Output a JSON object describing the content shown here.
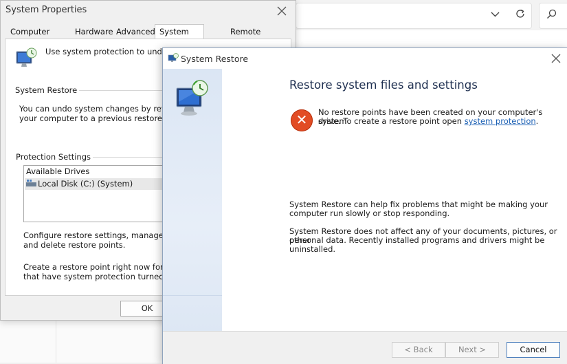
{
  "system_properties": {
    "title": "System Properties",
    "tabs": [
      {
        "label": "Computer Name"
      },
      {
        "label": "Hardware"
      },
      {
        "label": "Advanced"
      },
      {
        "label": "System Protection"
      },
      {
        "label": "Remote"
      }
    ],
    "intro_text": "Use system protection to undo unw",
    "system_restore_group": "System Restore",
    "system_restore_text_1": "You can undo system changes by revertin",
    "system_restore_text_2": "your computer to a previous restore point.",
    "protection_group": "Protection Settings",
    "drives_header": "Available Drives",
    "drive_item": "Local Disk (C:) (System)",
    "configure_text_1": "Configure restore settings, manage disk s",
    "configure_text_2": "and delete restore points.",
    "create_text_1": "Create a restore point right now for the dr",
    "create_text_2": "that have system protection turned on.",
    "ok_label": "OK"
  },
  "system_restore": {
    "title": "System Restore",
    "heading": "Restore system files and settings",
    "error_line_1": "No restore points have been created on your computer's system",
    "error_line_2": "drive. To create a restore point open",
    "error_link": "system protection",
    "error_end": ".",
    "info1_line_1": "System Restore can help fix problems that might be making your",
    "info1_line_2": "computer run slowly or stop responding.",
    "info2_line_1": "System Restore does not affect any of your documents, pictures, or other",
    "info2_line_2": "personal data. Recently installed programs and drivers might be",
    "info2_line_3": "uninstalled.",
    "back_label": "< Back",
    "next_label": "Next >",
    "cancel_label": "Cancel"
  },
  "icons": {
    "close": "close-icon",
    "chevron": "chevron-down-icon",
    "refresh": "refresh-icon",
    "search": "search-icon",
    "system_restore": "system-restore-icon",
    "drive": "drive-icon",
    "error": "error-icon"
  },
  "colors": {
    "link": "#1a5fb4",
    "error": "#e24c24",
    "heading": "#1e2f50",
    "sidebar": "#dbe6f4"
  }
}
